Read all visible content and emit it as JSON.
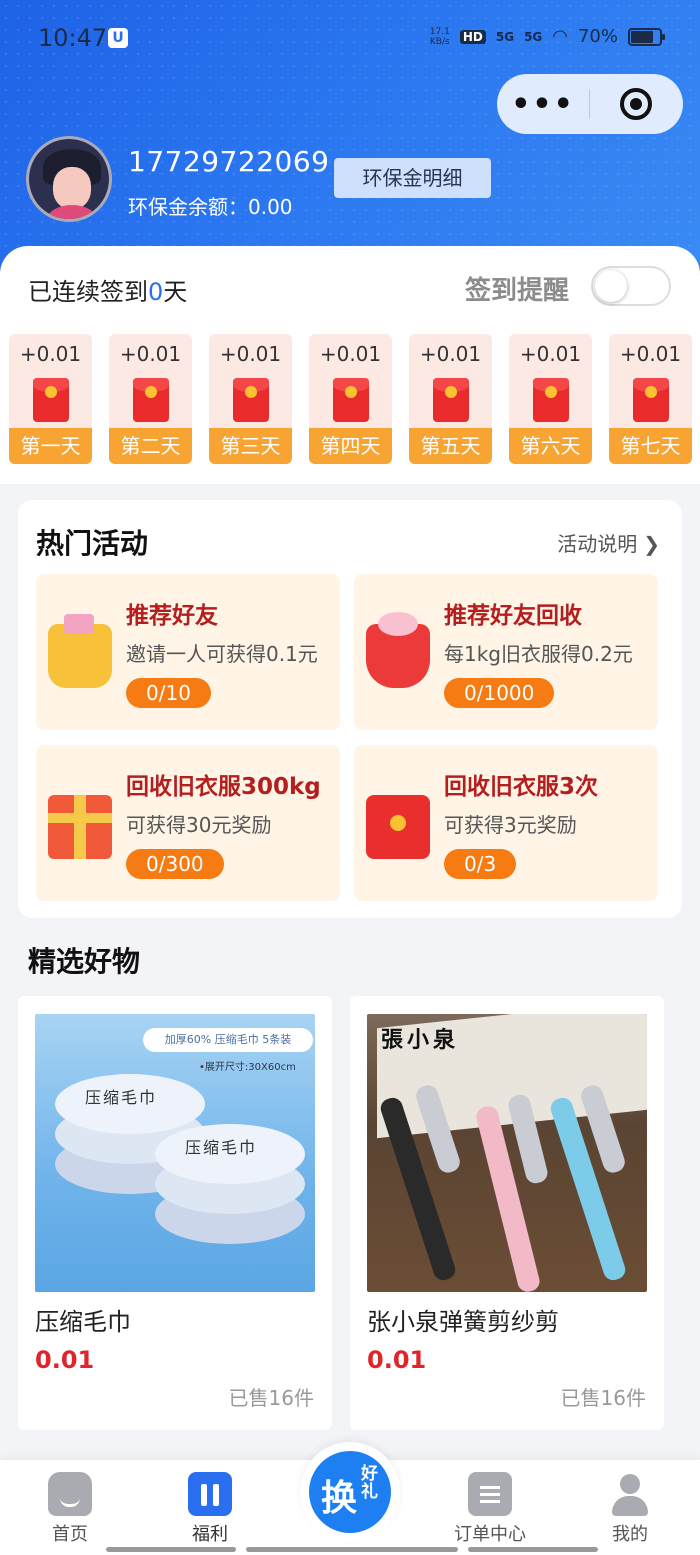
{
  "status_bar": {
    "time": "10:47",
    "net_speed": "17.1",
    "net_unit": "KB/s",
    "hd": "HD",
    "sig1": "5G",
    "sig2": "5G",
    "battery": "70%"
  },
  "capsule": {
    "more_label": "•••",
    "target_icon": "target-icon"
  },
  "user": {
    "phone": "17729722069",
    "balance_label": "环保金余额：0.00",
    "detail_button": "环保金明细"
  },
  "signin": {
    "prefix": "已连续签到",
    "days": "0",
    "suffix": "天",
    "remind_label": "签到提醒",
    "remind_on": false,
    "days_list": [
      {
        "amount": "+0.01",
        "label": "第一天"
      },
      {
        "amount": "+0.01",
        "label": "第二天"
      },
      {
        "amount": "+0.01",
        "label": "第三天"
      },
      {
        "amount": "+0.01",
        "label": "第四天"
      },
      {
        "amount": "+0.01",
        "label": "第五天"
      },
      {
        "amount": "+0.01",
        "label": "第六天"
      },
      {
        "amount": "+0.01",
        "label": "第七天"
      }
    ]
  },
  "activities": {
    "title": "热门活动",
    "link": "活动说明",
    "items": [
      {
        "title": "推荐好友",
        "desc": "邀请一人可获得0.1元",
        "progress": "0/10",
        "icon": "gift-bag-icon"
      },
      {
        "title": "推荐好友回收",
        "desc": "每1kg旧衣服得0.2元",
        "progress": "0/1000",
        "icon": "money-bowl-icon"
      },
      {
        "title": "回收旧衣服300kg",
        "desc": "可获得30元奖励",
        "progress": "0/300",
        "icon": "gift-box-icon"
      },
      {
        "title": "回收旧衣服3次",
        "desc": "可获得3元奖励",
        "progress": "0/3",
        "icon": "red-envelope-icon"
      }
    ]
  },
  "goods": {
    "title": "精选好物",
    "items": [
      {
        "name": "压缩毛巾",
        "price": "0.01",
        "sold": "已售16件",
        "img_tag": "加厚60% 压缩毛巾 5条装",
        "img_size": "•展开尺寸:30X60cm",
        "img_text": "压缩毛巾"
      },
      {
        "name": "张小泉弹簧剪纱剪",
        "price": "0.01",
        "sold": "已售16件",
        "img_brand": "張小泉"
      }
    ]
  },
  "tabbar": {
    "items": [
      {
        "label": "首页"
      },
      {
        "label": "福利"
      },
      {
        "label": "订单中心"
      },
      {
        "label": "我的"
      }
    ],
    "center_big": "换",
    "center_small": "好礼"
  }
}
